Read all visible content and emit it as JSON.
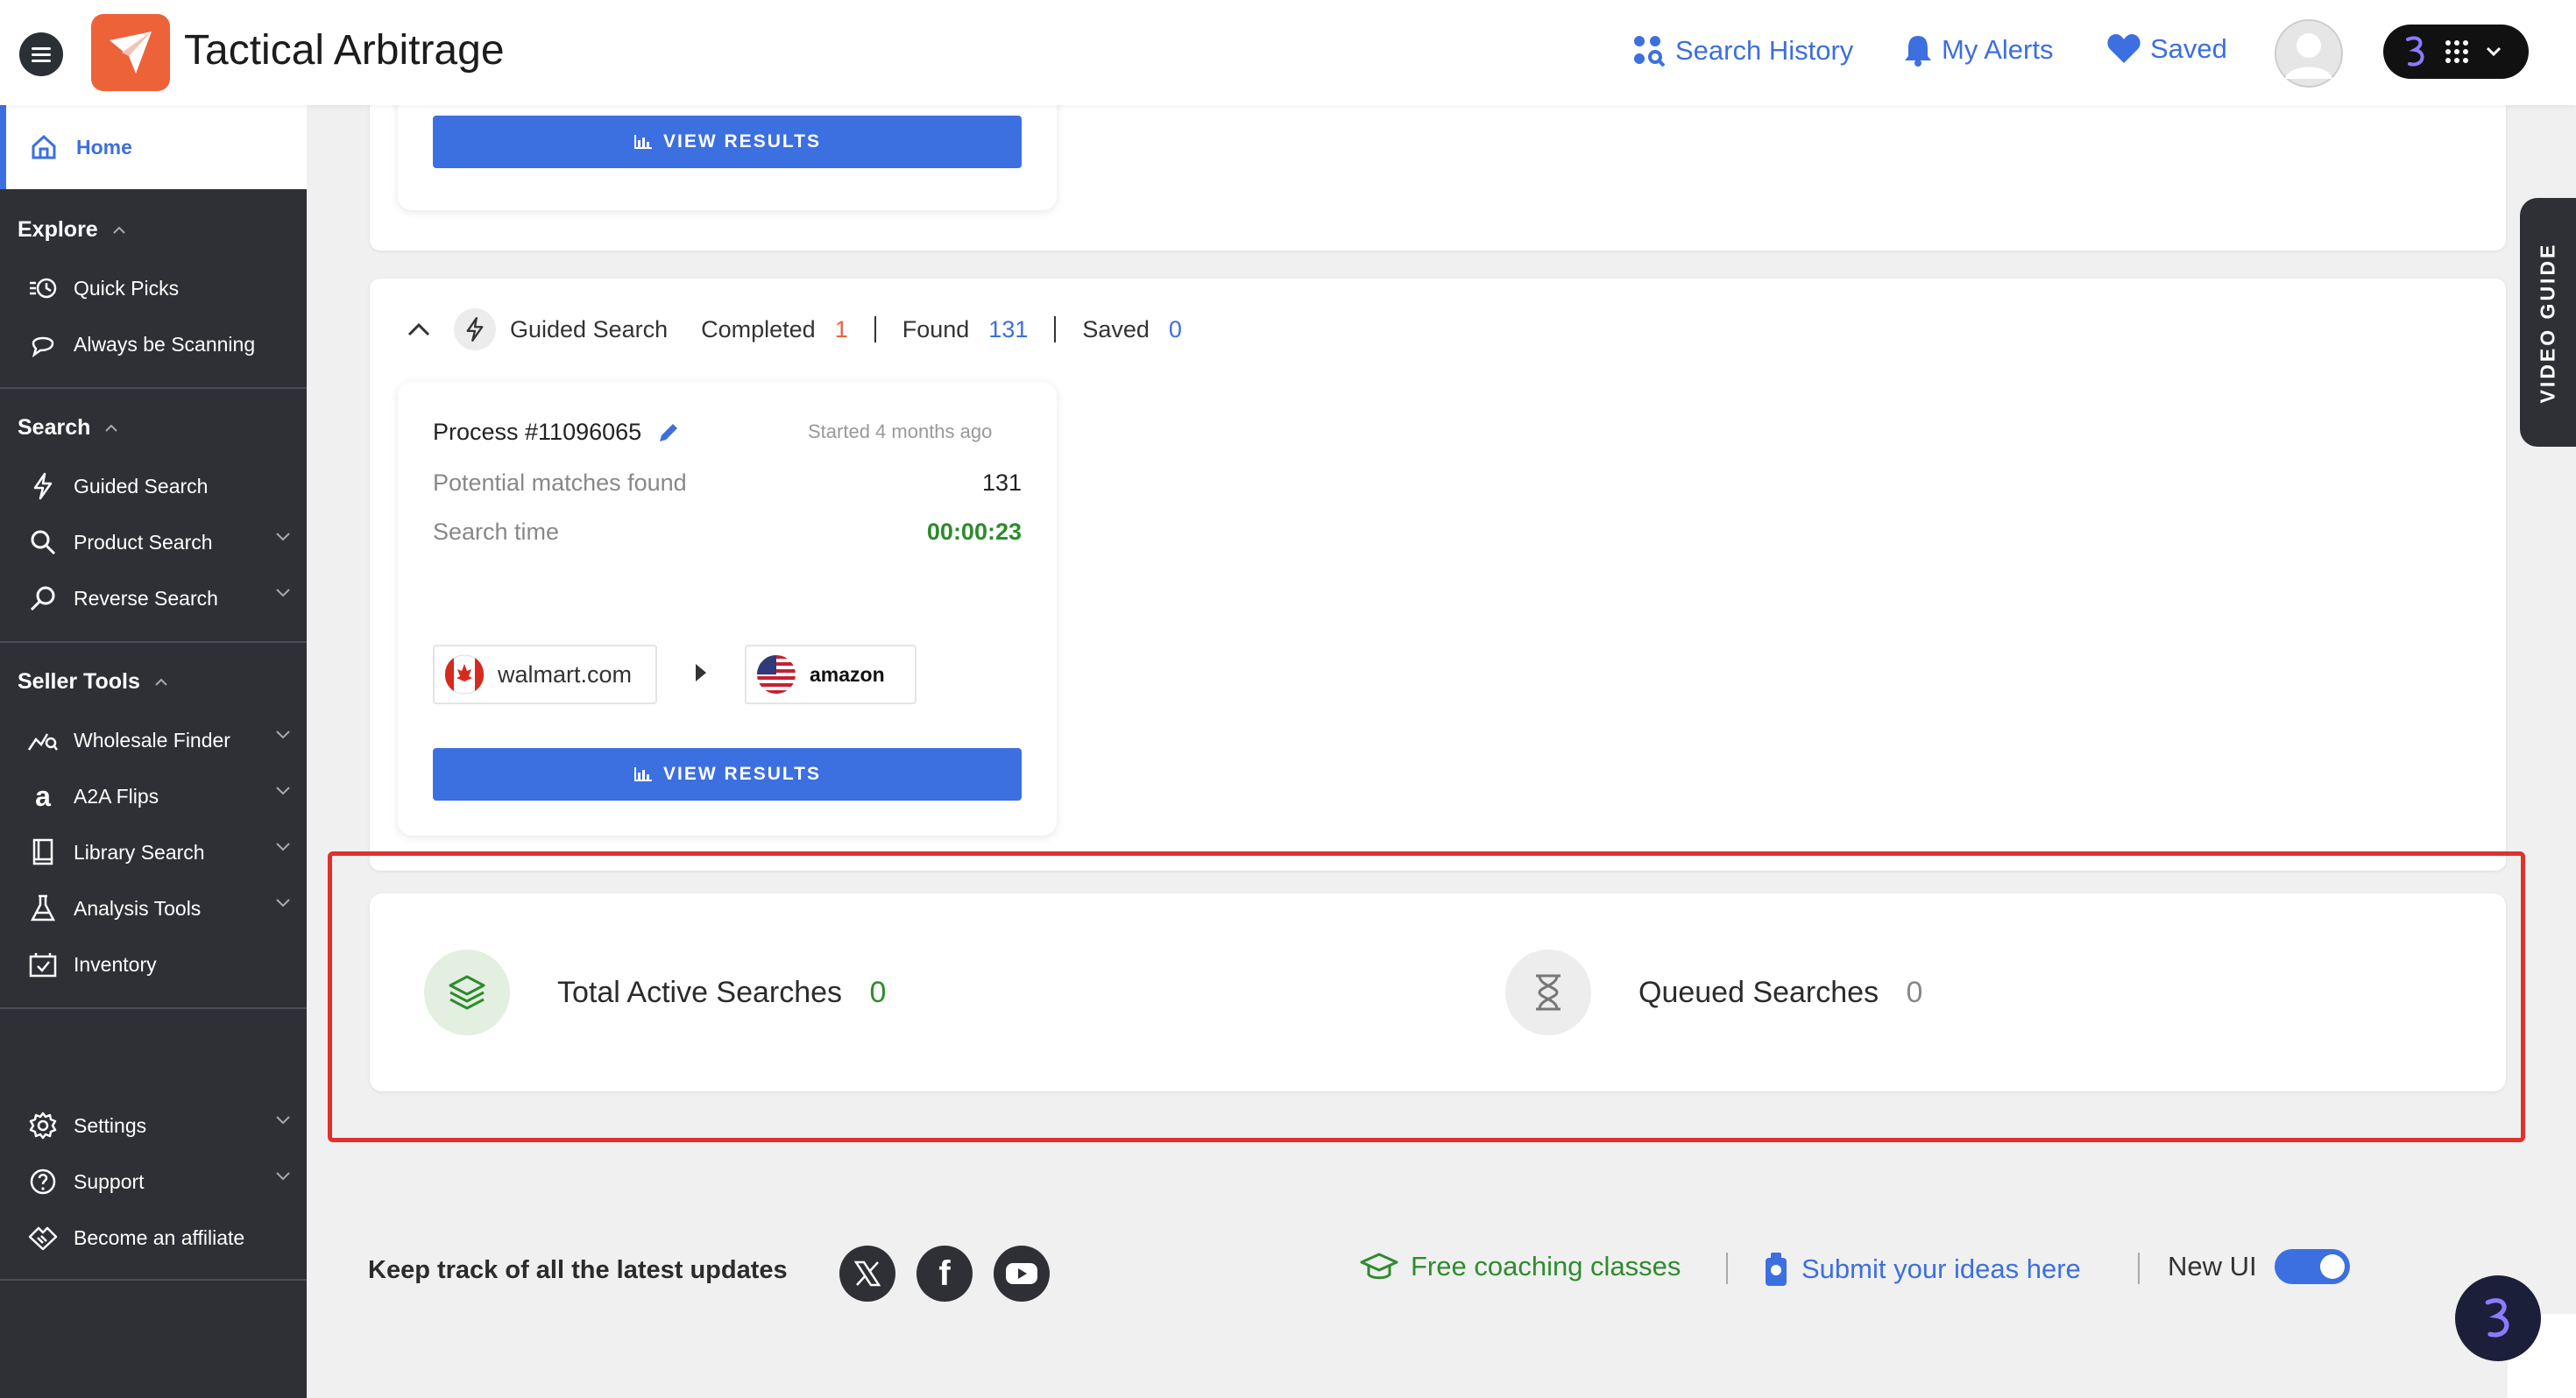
{
  "header": {
    "app_title": "Tactical Arbitrage",
    "links": [
      {
        "label": "Search History",
        "icon": "search-history-icon"
      },
      {
        "label": "My Alerts",
        "icon": "bell-icon"
      },
      {
        "label": "Saved",
        "icon": "heart-icon"
      }
    ]
  },
  "sidebar": {
    "home": "Home",
    "sections": [
      {
        "title": "Explore",
        "items": [
          "Quick Picks",
          "Always be Scanning"
        ]
      },
      {
        "title": "Search",
        "items": [
          "Guided Search",
          "Product Search",
          "Reverse Search"
        ]
      },
      {
        "title": "Seller Tools",
        "items": [
          "Wholesale Finder",
          "A2A Flips",
          "Library Search",
          "Analysis Tools",
          "Inventory"
        ]
      }
    ],
    "bottom_items": [
      "Settings",
      "Support",
      "Become an affiliate"
    ]
  },
  "top_card": {
    "button": "VIEW RESULTS"
  },
  "guided_search": {
    "title": "Guided Search",
    "completed_label": "Completed",
    "completed_value": "1",
    "found_label": "Found",
    "found_value": "131",
    "saved_label": "Saved",
    "saved_value": "0"
  },
  "process": {
    "name": "Process #11096065",
    "started": "Started 4 months ago",
    "matches_label": "Potential matches found",
    "matches_value": "131",
    "time_label": "Search time",
    "time_value": "00:00:23",
    "source": "walmart.com",
    "target": "amazon",
    "button": "VIEW RESULTS"
  },
  "stats": {
    "active_label": "Total Active Searches",
    "active_value": "0",
    "queued_label": "Queued Searches",
    "queued_value": "0"
  },
  "footer": {
    "updates_text": "Keep track of all the latest updates",
    "coaching": "Free coaching classes",
    "ideas": "Submit your ideas here",
    "new_ui": "New UI"
  },
  "video_guide": "VIDEO GUIDE",
  "colors": {
    "accent": "#3c6fe0",
    "brand": "#ee6239",
    "success": "#2e8b2e",
    "highlight": "#e0312d"
  }
}
